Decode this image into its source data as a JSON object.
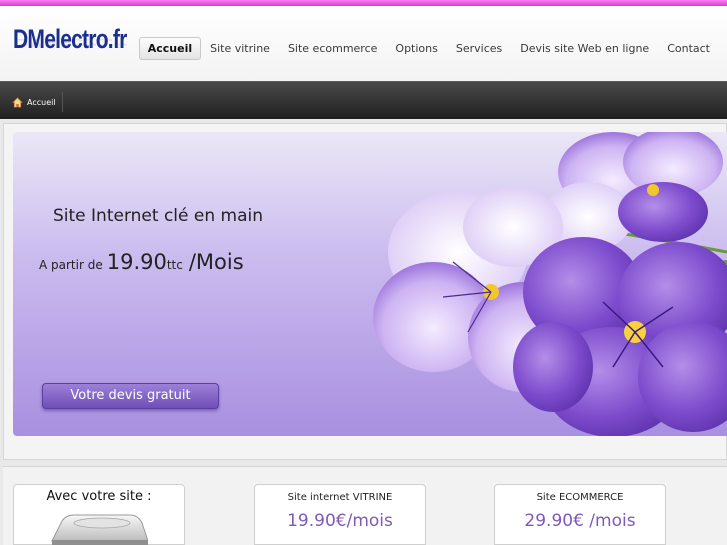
{
  "site": {
    "logo": "DMelectro.fr"
  },
  "nav": {
    "items": [
      {
        "label": "Accueil",
        "active": true
      },
      {
        "label": "Site vitrine"
      },
      {
        "label": "Site ecommerce"
      },
      {
        "label": "Options"
      },
      {
        "label": "Services"
      },
      {
        "label": "Devis site Web en ligne"
      },
      {
        "label": "Contact"
      }
    ]
  },
  "breadcrumb": {
    "home_icon": "home-icon",
    "label": "Accueil"
  },
  "hero": {
    "title": "Site Internet clé en main",
    "price_prefix": "A partir de",
    "price_amount": "19.90",
    "price_ttc": "ttc",
    "price_period": "/Mois",
    "cta_label": "Votre devis gratuit"
  },
  "cards": {
    "intro_title": "Avec votre site :",
    "vitrine": {
      "label": "Site internet VITRINE",
      "price": "19.90€/mois"
    },
    "ecommerce": {
      "label": "Site ECOMMERCE",
      "price": "29.90€ /mois"
    }
  },
  "colors": {
    "accent_magenta": "#d63fd2",
    "logo_blue": "#1b2f8e",
    "hero_purple": "#a98fe0",
    "price_purple": "#7e5ab8"
  }
}
